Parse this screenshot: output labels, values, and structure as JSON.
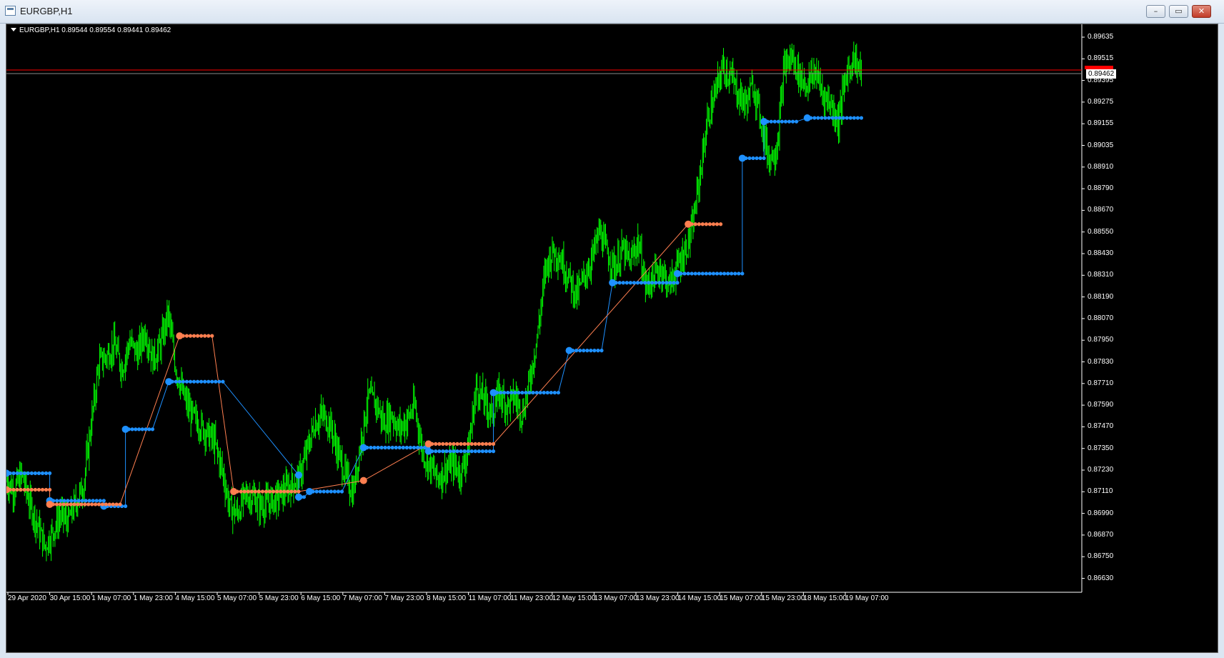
{
  "window": {
    "title": "EURGBP,H1",
    "buttons": {
      "minimize": "–",
      "restore": "▭",
      "close": "✕"
    }
  },
  "chart_header": {
    "symbol_text": "EURGBP,H1  0.89544 0.89554 0.89441 0.89462"
  },
  "colors": {
    "background": "#000000",
    "candles": "#00ff00",
    "stop_up": "#1e90ff",
    "stop_down": "#ff7f50",
    "bid_line": "#ff0000",
    "grid_text": "#ffffff"
  },
  "price_axis": {
    "labels": [
      "0.89635",
      "0.89515",
      "0.89395",
      "0.89275",
      "0.89155",
      "0.89035",
      "0.88910",
      "0.88790",
      "0.88670",
      "0.88550",
      "0.88430",
      "0.88310",
      "0.88190",
      "0.88070",
      "0.87950",
      "0.87830",
      "0.87710",
      "0.87590",
      "0.87470",
      "0.87350",
      "0.87230",
      "0.87110",
      "0.86990",
      "0.86870",
      "0.86750",
      "0.86630"
    ],
    "current_price": "0.89462"
  },
  "time_axis": {
    "labels": [
      "29 Apr 2020",
      "30 Apr 15:00",
      "1 May 07:00",
      "1 May 23:00",
      "4 May 15:00",
      "5 May 07:00",
      "5 May 23:00",
      "6 May 15:00",
      "7 May 07:00",
      "7 May 23:00",
      "8 May 15:00",
      "11 May 07:00",
      "11 May 23:00",
      "12 May 15:00",
      "13 May 07:00",
      "13 May 23:00",
      "14 May 15:00",
      "15 May 07:00",
      "15 May 23:00",
      "18 May 15:00",
      "19 May 07:00"
    ]
  },
  "chart_data": {
    "type": "line",
    "symbol": "EURGBP",
    "timeframe": "H1",
    "ohlc_last": {
      "open": 0.89544,
      "high": 0.89554,
      "low": 0.89441,
      "close": 0.89462
    },
    "ylim": [
      0.8663,
      0.897
    ],
    "price_path": [
      0.8724,
      0.8719,
      0.8727,
      0.8712,
      0.87,
      0.8688,
      0.8696,
      0.8705,
      0.8702,
      0.8712,
      0.8721,
      0.8755,
      0.8788,
      0.8792,
      0.8798,
      0.8785,
      0.88,
      0.8793,
      0.8806,
      0.879,
      0.8798,
      0.8815,
      0.8785,
      0.877,
      0.876,
      0.8755,
      0.875,
      0.8745,
      0.873,
      0.8709,
      0.8706,
      0.8716,
      0.8715,
      0.871,
      0.8712,
      0.8714,
      0.8718,
      0.8722,
      0.8725,
      0.874,
      0.8755,
      0.876,
      0.8755,
      0.874,
      0.8727,
      0.8717,
      0.8745,
      0.877,
      0.8766,
      0.8755,
      0.876,
      0.8752,
      0.8757,
      0.8765,
      0.874,
      0.8732,
      0.8725,
      0.873,
      0.8733,
      0.8728,
      0.8742,
      0.8775,
      0.8768,
      0.876,
      0.8772,
      0.8765,
      0.877,
      0.876,
      0.878,
      0.8805,
      0.884,
      0.885,
      0.8845,
      0.8835,
      0.8825,
      0.8835,
      0.8845,
      0.886,
      0.8848,
      0.884,
      0.885,
      0.8843,
      0.8855,
      0.883,
      0.8835,
      0.884,
      0.883,
      0.884,
      0.8848,
      0.886,
      0.889,
      0.892,
      0.8935,
      0.895,
      0.8945,
      0.8935,
      0.893,
      0.894,
      0.892,
      0.89,
      0.8905,
      0.895,
      0.8955,
      0.8945,
      0.894,
      0.8948,
      0.8935,
      0.893,
      0.892,
      0.8945,
      0.8955,
      0.8946
    ],
    "stop_up_series": [
      {
        "x0": 0.0,
        "x1": 0.04,
        "y": 0.8728
      },
      {
        "x0": 0.04,
        "x1": 0.09,
        "y": 0.8713
      },
      {
        "x0": 0.09,
        "x1": 0.11,
        "y": 0.871
      },
      {
        "x0": 0.11,
        "x1": 0.135,
        "y": 0.8752
      },
      {
        "x0": 0.15,
        "x1": 0.2,
        "y": 0.8778
      },
      {
        "x0": 0.27,
        "x1": 0.27,
        "y": 0.8727
      },
      {
        "x0": 0.27,
        "x1": 0.275,
        "y": 0.8715
      },
      {
        "x0": 0.28,
        "x1": 0.31,
        "y": 0.8718
      },
      {
        "x0": 0.33,
        "x1": 0.39,
        "y": 0.8742
      },
      {
        "x0": 0.39,
        "x1": 0.45,
        "y": 0.874
      },
      {
        "x0": 0.45,
        "x1": 0.51,
        "y": 0.8772
      },
      {
        "x0": 0.52,
        "x1": 0.55,
        "y": 0.8795
      },
      {
        "x0": 0.56,
        "x1": 0.62,
        "y": 0.8832
      },
      {
        "x0": 0.62,
        "x1": 0.68,
        "y": 0.8837
      },
      {
        "x0": 0.68,
        "x1": 0.7,
        "y": 0.89
      },
      {
        "x0": 0.7,
        "x1": 0.73,
        "y": 0.892
      },
      {
        "x0": 0.74,
        "x1": 0.79,
        "y": 0.8922
      }
    ],
    "stop_down_series": [
      {
        "x0": 0.0,
        "x1": 0.04,
        "y": 0.8719
      },
      {
        "x0": 0.04,
        "x1": 0.105,
        "y": 0.8711
      },
      {
        "x0": 0.16,
        "x1": 0.19,
        "y": 0.8803
      },
      {
        "x0": 0.21,
        "x1": 0.27,
        "y": 0.8718
      },
      {
        "x0": 0.33,
        "x1": 0.33,
        "y": 0.8724
      },
      {
        "x0": 0.39,
        "x1": 0.45,
        "y": 0.8744
      },
      {
        "x0": 0.63,
        "x1": 0.66,
        "y": 0.8864
      }
    ],
    "current_price": 0.89462
  }
}
